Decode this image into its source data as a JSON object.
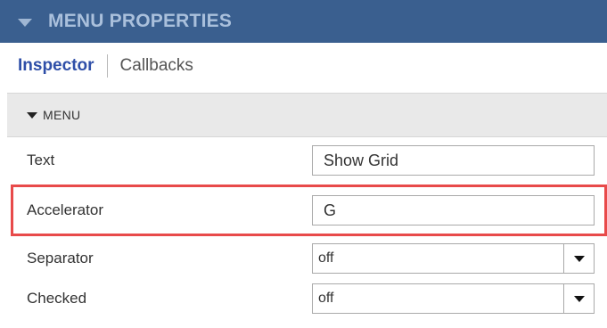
{
  "header": {
    "title": "MENU PROPERTIES",
    "collapse_icon": "caret-down-icon"
  },
  "tabs": [
    {
      "label": "Inspector",
      "active": true
    },
    {
      "label": "Callbacks",
      "active": false
    }
  ],
  "section": {
    "label": "MENU",
    "icon": "caret-down-icon"
  },
  "properties": {
    "text": {
      "label": "Text",
      "value": "Show Grid"
    },
    "accelerator": {
      "label": "Accelerator",
      "value": "G"
    },
    "separator": {
      "label": "Separator",
      "value": "off"
    },
    "checked": {
      "label": "Checked",
      "value": "off"
    }
  },
  "colors": {
    "header_bg": "#3a5f8f",
    "active_tab": "#2f4fa8",
    "highlight": "#e84a4a",
    "section_bg": "#e9e9e9"
  }
}
